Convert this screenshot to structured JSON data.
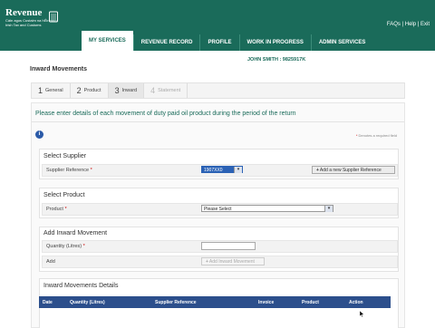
{
  "header": {
    "logo_title": "Revenue",
    "logo_line1": "Cáin agus Custaim na hÉireann",
    "logo_line2": "Irish Tax and Customs",
    "links": "FAQs | Help | Exit"
  },
  "tabs": [
    {
      "label": "MY SERVICES",
      "active": true
    },
    {
      "label": "REVENUE RECORD",
      "active": false
    },
    {
      "label": "PROFILE",
      "active": false
    },
    {
      "label": "WORK IN PROGRESS",
      "active": false
    },
    {
      "label": "ADMIN SERVICES",
      "active": false
    }
  ],
  "user": "JOHN SMITH : 9825917K",
  "page_title": "Inward Movements",
  "steps": [
    {
      "num": "1",
      "label": "General"
    },
    {
      "num": "2",
      "label": "Product"
    },
    {
      "num": "3",
      "label": "Inward"
    },
    {
      "num": "4",
      "label": "Statement"
    }
  ],
  "intro_text": "Please enter details of each movement of duty paid oil product during the period of the return",
  "required_note": "Denotes a required field",
  "select_supplier": {
    "heading": "Select Supplier",
    "label": "Supplier Reference",
    "selected": "1907XX0",
    "add_button": "Add a new Supplier Reference"
  },
  "select_product": {
    "heading": "Select Product",
    "label": "Product",
    "selected": "Please Select"
  },
  "add_movement": {
    "heading": "Add Inward Movement",
    "quantity_label": "Quantity (Litres)",
    "quantity_value": "",
    "add_label": "Add",
    "add_button": "Add Inward Movement"
  },
  "details": {
    "heading": "Inward Movements Details",
    "columns": [
      "Date",
      "Quantity (Litres)",
      "Supplier Reference",
      "Invoice",
      "Product",
      "Action"
    ]
  },
  "colors": {
    "brand": "#1a6b5a",
    "table_header": "#2c4f8c",
    "required": "#cc0000"
  },
  "icons": [
    "harp-icon",
    "info-icon",
    "plus-icon",
    "chevron-down-icon",
    "mouse-cursor-icon"
  ]
}
